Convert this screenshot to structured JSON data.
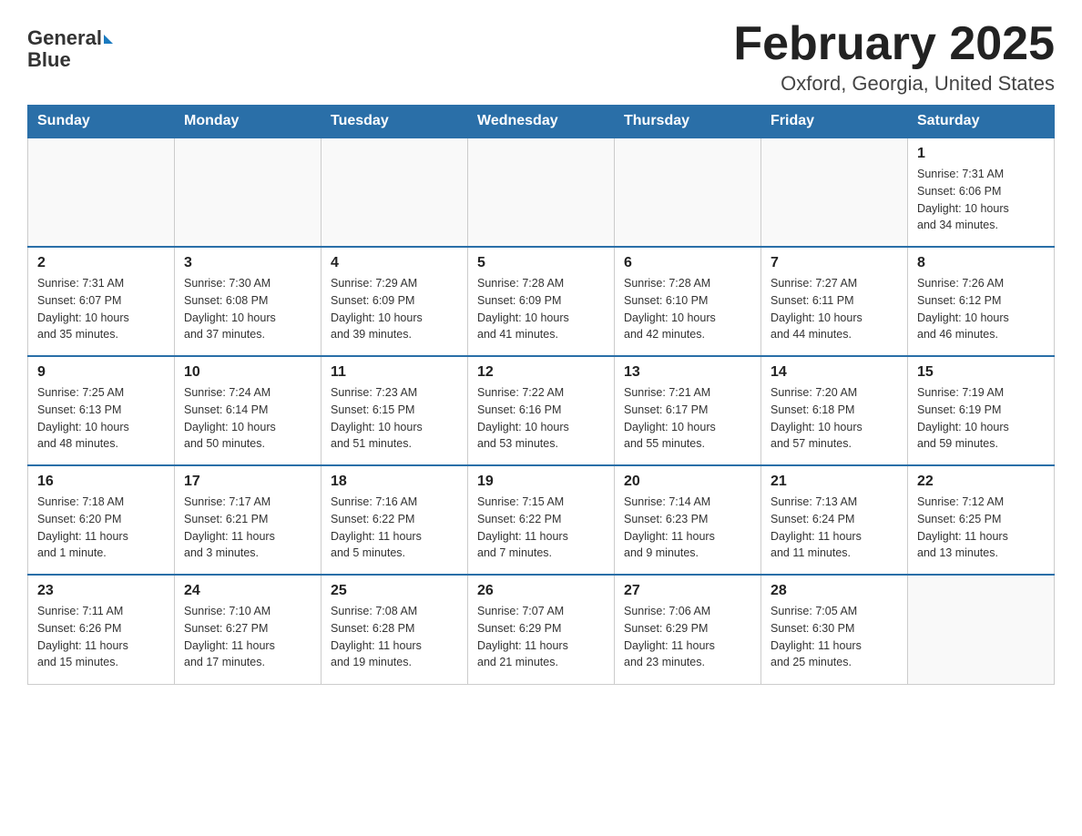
{
  "header": {
    "logo_line1": "General",
    "logo_line2": "Blue",
    "title": "February 2025",
    "subtitle": "Oxford, Georgia, United States"
  },
  "calendar": {
    "days_of_week": [
      "Sunday",
      "Monday",
      "Tuesday",
      "Wednesday",
      "Thursday",
      "Friday",
      "Saturday"
    ],
    "weeks": [
      [
        {
          "day": "",
          "info": ""
        },
        {
          "day": "",
          "info": ""
        },
        {
          "day": "",
          "info": ""
        },
        {
          "day": "",
          "info": ""
        },
        {
          "day": "",
          "info": ""
        },
        {
          "day": "",
          "info": ""
        },
        {
          "day": "1",
          "info": "Sunrise: 7:31 AM\nSunset: 6:06 PM\nDaylight: 10 hours\nand 34 minutes."
        }
      ],
      [
        {
          "day": "2",
          "info": "Sunrise: 7:31 AM\nSunset: 6:07 PM\nDaylight: 10 hours\nand 35 minutes."
        },
        {
          "day": "3",
          "info": "Sunrise: 7:30 AM\nSunset: 6:08 PM\nDaylight: 10 hours\nand 37 minutes."
        },
        {
          "day": "4",
          "info": "Sunrise: 7:29 AM\nSunset: 6:09 PM\nDaylight: 10 hours\nand 39 minutes."
        },
        {
          "day": "5",
          "info": "Sunrise: 7:28 AM\nSunset: 6:09 PM\nDaylight: 10 hours\nand 41 minutes."
        },
        {
          "day": "6",
          "info": "Sunrise: 7:28 AM\nSunset: 6:10 PM\nDaylight: 10 hours\nand 42 minutes."
        },
        {
          "day": "7",
          "info": "Sunrise: 7:27 AM\nSunset: 6:11 PM\nDaylight: 10 hours\nand 44 minutes."
        },
        {
          "day": "8",
          "info": "Sunrise: 7:26 AM\nSunset: 6:12 PM\nDaylight: 10 hours\nand 46 minutes."
        }
      ],
      [
        {
          "day": "9",
          "info": "Sunrise: 7:25 AM\nSunset: 6:13 PM\nDaylight: 10 hours\nand 48 minutes."
        },
        {
          "day": "10",
          "info": "Sunrise: 7:24 AM\nSunset: 6:14 PM\nDaylight: 10 hours\nand 50 minutes."
        },
        {
          "day": "11",
          "info": "Sunrise: 7:23 AM\nSunset: 6:15 PM\nDaylight: 10 hours\nand 51 minutes."
        },
        {
          "day": "12",
          "info": "Sunrise: 7:22 AM\nSunset: 6:16 PM\nDaylight: 10 hours\nand 53 minutes."
        },
        {
          "day": "13",
          "info": "Sunrise: 7:21 AM\nSunset: 6:17 PM\nDaylight: 10 hours\nand 55 minutes."
        },
        {
          "day": "14",
          "info": "Sunrise: 7:20 AM\nSunset: 6:18 PM\nDaylight: 10 hours\nand 57 minutes."
        },
        {
          "day": "15",
          "info": "Sunrise: 7:19 AM\nSunset: 6:19 PM\nDaylight: 10 hours\nand 59 minutes."
        }
      ],
      [
        {
          "day": "16",
          "info": "Sunrise: 7:18 AM\nSunset: 6:20 PM\nDaylight: 11 hours\nand 1 minute."
        },
        {
          "day": "17",
          "info": "Sunrise: 7:17 AM\nSunset: 6:21 PM\nDaylight: 11 hours\nand 3 minutes."
        },
        {
          "day": "18",
          "info": "Sunrise: 7:16 AM\nSunset: 6:22 PM\nDaylight: 11 hours\nand 5 minutes."
        },
        {
          "day": "19",
          "info": "Sunrise: 7:15 AM\nSunset: 6:22 PM\nDaylight: 11 hours\nand 7 minutes."
        },
        {
          "day": "20",
          "info": "Sunrise: 7:14 AM\nSunset: 6:23 PM\nDaylight: 11 hours\nand 9 minutes."
        },
        {
          "day": "21",
          "info": "Sunrise: 7:13 AM\nSunset: 6:24 PM\nDaylight: 11 hours\nand 11 minutes."
        },
        {
          "day": "22",
          "info": "Sunrise: 7:12 AM\nSunset: 6:25 PM\nDaylight: 11 hours\nand 13 minutes."
        }
      ],
      [
        {
          "day": "23",
          "info": "Sunrise: 7:11 AM\nSunset: 6:26 PM\nDaylight: 11 hours\nand 15 minutes."
        },
        {
          "day": "24",
          "info": "Sunrise: 7:10 AM\nSunset: 6:27 PM\nDaylight: 11 hours\nand 17 minutes."
        },
        {
          "day": "25",
          "info": "Sunrise: 7:08 AM\nSunset: 6:28 PM\nDaylight: 11 hours\nand 19 minutes."
        },
        {
          "day": "26",
          "info": "Sunrise: 7:07 AM\nSunset: 6:29 PM\nDaylight: 11 hours\nand 21 minutes."
        },
        {
          "day": "27",
          "info": "Sunrise: 7:06 AM\nSunset: 6:29 PM\nDaylight: 11 hours\nand 23 minutes."
        },
        {
          "day": "28",
          "info": "Sunrise: 7:05 AM\nSunset: 6:30 PM\nDaylight: 11 hours\nand 25 minutes."
        },
        {
          "day": "",
          "info": ""
        }
      ]
    ]
  }
}
